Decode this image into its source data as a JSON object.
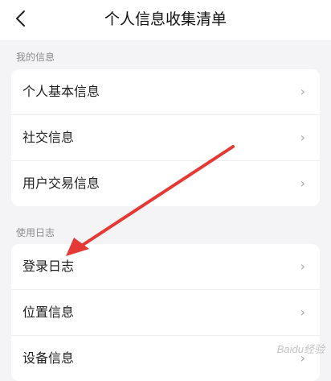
{
  "header": {
    "title": "个人信息收集清单"
  },
  "sections": [
    {
      "label": "我的信息",
      "items": [
        {
          "label": "个人基本信息"
        },
        {
          "label": "社交信息"
        },
        {
          "label": "用户交易信息"
        }
      ]
    },
    {
      "label": "使用日志",
      "items": [
        {
          "label": "登录日志"
        },
        {
          "label": "位置信息"
        },
        {
          "label": "设备信息"
        }
      ]
    }
  ],
  "chevron": "›",
  "annotation": {
    "color": "#e53935"
  },
  "watermark": "Baidu经验"
}
